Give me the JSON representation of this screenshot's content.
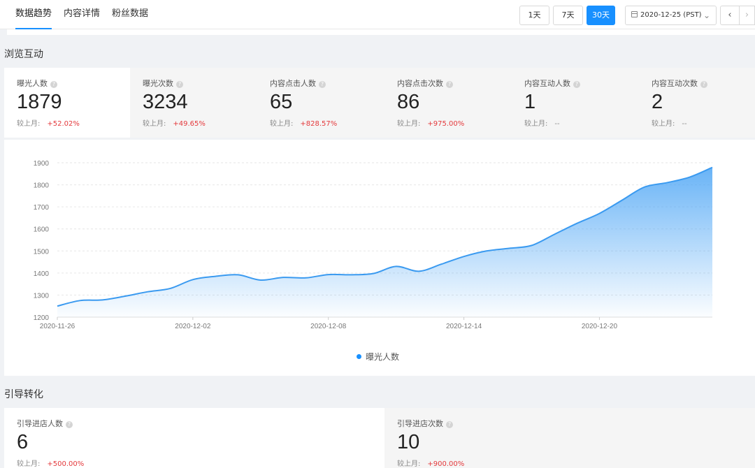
{
  "tabs": [
    {
      "label": "数据趋势"
    },
    {
      "label": "内容详情"
    },
    {
      "label": "粉丝数据"
    }
  ],
  "range_buttons": [
    {
      "label": "1天"
    },
    {
      "label": "7天"
    },
    {
      "label": "30天",
      "active": true
    }
  ],
  "date_picker": {
    "value": "2020-12-25 (PST)"
  },
  "sections": {
    "browse": "浏览互动",
    "conversion": "引导转化"
  },
  "compare_label": "较上月:",
  "metrics": [
    {
      "label": "曝光人数",
      "value": "1879",
      "change": "+52.02%"
    },
    {
      "label": "曝光次数",
      "value": "3234",
      "change": "+49.65%"
    },
    {
      "label": "内容点击人数",
      "value": "65",
      "change": "+828.57%"
    },
    {
      "label": "内容点击次数",
      "value": "86",
      "change": "+975.00%"
    },
    {
      "label": "内容互动人数",
      "value": "1",
      "change": "--"
    },
    {
      "label": "内容互动次数",
      "value": "2",
      "change": "--"
    }
  ],
  "conversion_metrics": [
    {
      "label": "引导进店人数",
      "value": "6",
      "change": "+500.00%"
    },
    {
      "label": "引导进店次数",
      "value": "10",
      "change": "+900.00%"
    }
  ],
  "colors": {
    "accent": "#1890ff",
    "line": "#3a9af0",
    "positive": "#e4393c"
  },
  "chart_data": {
    "type": "area",
    "x": [
      "2020-11-26",
      "2020-11-27",
      "2020-11-28",
      "2020-11-29",
      "2020-11-30",
      "2020-12-01",
      "2020-12-02",
      "2020-12-03",
      "2020-12-04",
      "2020-12-05",
      "2020-12-06",
      "2020-12-07",
      "2020-12-08",
      "2020-12-09",
      "2020-12-10",
      "2020-12-11",
      "2020-12-12",
      "2020-12-13",
      "2020-12-14",
      "2020-12-15",
      "2020-12-16",
      "2020-12-17",
      "2020-12-18",
      "2020-12-19",
      "2020-12-20",
      "2020-12-21",
      "2020-12-22",
      "2020-12-23",
      "2020-12-24",
      "2020-12-25"
    ],
    "xticks": [
      "2020-11-26",
      "2020-12-02",
      "2020-12-08",
      "2020-12-14",
      "2020-12-20"
    ],
    "series": [
      {
        "name": "曝光人数",
        "values": [
          1250,
          1275,
          1278,
          1295,
          1315,
          1330,
          1370,
          1385,
          1392,
          1368,
          1380,
          1378,
          1393,
          1392,
          1398,
          1430,
          1408,
          1440,
          1475,
          1500,
          1512,
          1525,
          1575,
          1625,
          1670,
          1730,
          1790,
          1810,
          1835,
          1879
        ]
      }
    ],
    "ylim": [
      1200,
      1900
    ],
    "yticks": [
      1200,
      1300,
      1400,
      1500,
      1600,
      1700,
      1800,
      1900
    ],
    "grid": true,
    "legend": "bottom-center"
  }
}
